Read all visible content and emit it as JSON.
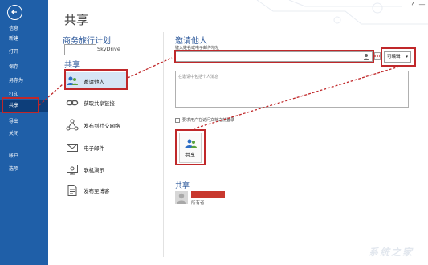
{
  "sidebar": {
    "items": [
      {
        "label": "信息"
      },
      {
        "label": "新建"
      },
      {
        "label": "打开"
      },
      {
        "label": "保存"
      },
      {
        "label": "另存为"
      },
      {
        "label": "打印"
      },
      {
        "label": "共享"
      },
      {
        "label": "导出"
      },
      {
        "label": "关闭"
      },
      {
        "label": "帐户"
      },
      {
        "label": "选项"
      }
    ],
    "active": "共享"
  },
  "header": {
    "title": "共享"
  },
  "document": {
    "name": "商务旅行计划",
    "location": "SkyDrive"
  },
  "share_options": {
    "heading": "共享",
    "items": [
      {
        "label": "邀请他人"
      },
      {
        "label": "获取共享链接"
      },
      {
        "label": "发布到社交网络"
      },
      {
        "label": "电子邮件"
      },
      {
        "label": "联机演示"
      },
      {
        "label": "发布至博客"
      }
    ]
  },
  "invite": {
    "title": "邀请他人",
    "email_label": "键入姓名或电子邮件地址",
    "email_value": "",
    "permission": "可编辑",
    "message_placeholder": "在邀请中包括个人消息",
    "require_signin_label": "要求用户在访问文档之前登录",
    "share_button": "共享"
  },
  "shared_with": {
    "title": "共享",
    "role": "所有者"
  },
  "watermark": "系统之家",
  "colors": {
    "sidebar": "#1f5fa8",
    "accent": "#2b579a",
    "highlight": "#c0282a"
  }
}
